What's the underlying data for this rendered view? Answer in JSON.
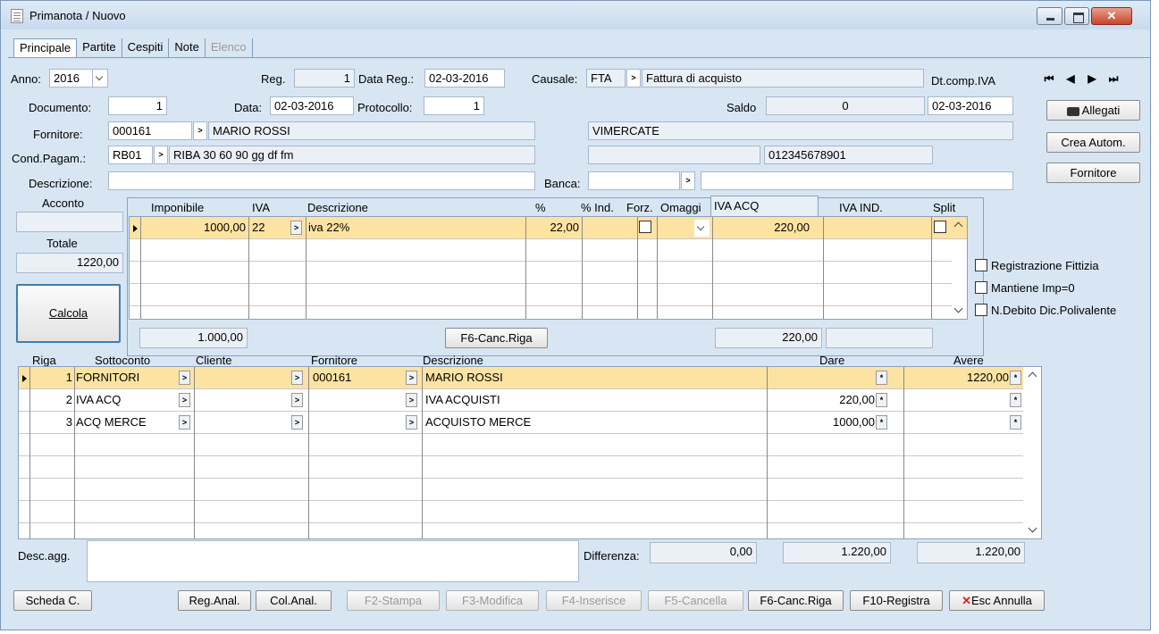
{
  "window": {
    "title": "Primanota / Nuovo",
    "close": "✕"
  },
  "tabs": [
    {
      "label": "Principale",
      "active": true
    },
    {
      "label": "Partite"
    },
    {
      "label": "Cespiti"
    },
    {
      "label": "Note"
    },
    {
      "label": "Elenco",
      "disabled": true
    }
  ],
  "header": {
    "anno_label": "Anno:",
    "anno_value": "2016",
    "reg_label": "Reg.",
    "reg_value": "1",
    "data_reg_label": "Data Reg.:",
    "data_reg_value": "02-03-2016",
    "causale_label": "Causale:",
    "causale_code": "FTA",
    "causale_desc": "Fattura di acquisto",
    "dt_comp_iva_label": "Dt.comp.IVA",
    "dt_comp_iva_value": "02-03-2016",
    "documento_label": "Documento:",
    "documento_value": "1",
    "data_label": "Data:",
    "data_value": "02-03-2016",
    "protocollo_label": "Protocollo:",
    "protocollo_value": "1",
    "saldo_label": "Saldo",
    "saldo_value": "0",
    "fornitore_label": "Fornitore:",
    "fornitore_code": "000161",
    "fornitore_name": "MARIO ROSSI",
    "citta_value": "VIMERCATE",
    "cond_pagam_label": "Cond.Pagam.:",
    "cond_pagam_code": "RB01",
    "cond_pagam_desc": "RIBA 30 60 90 gg df fm",
    "piva_value": "012345678901",
    "descrizione_label": "Descrizione:",
    "descrizione_value": "",
    "banca_label": "Banca:"
  },
  "side_buttons": {
    "allegati": "Allegati",
    "crea_autom": "Crea Autom.",
    "fornitore": "Fornitore"
  },
  "nav_buttons": [
    "⏮",
    "◀",
    "▶",
    "⏭"
  ],
  "left_panel": {
    "acconto_label": "Acconto",
    "acconto_value": "",
    "totale_label": "Totale",
    "totale_value": "1220,00",
    "calcola_label": "Calcola"
  },
  "iva_grid": {
    "headers": [
      "Imponibile",
      "IVA",
      "Descrizione",
      "%",
      "% Ind.",
      "Forz.",
      "Omaggi",
      "IVA ACQ",
      "IVA IND.",
      "Split"
    ],
    "rows": [
      {
        "imponibile": "1000,00",
        "iva": "22",
        "descrizione": "iva 22%",
        "perc": "22,00",
        "perc_ind": "",
        "iva_acq": "220,00",
        "iva_ind": ""
      }
    ],
    "total_imponibile": "1.000,00",
    "canc_riga": "F6-Canc.Riga",
    "total_iva_acq": "220,00",
    "total_iva_ind": ""
  },
  "options": {
    "reg_fittizia": "Registrazione Fittizia",
    "mantiene_imp": "Mantiene Imp=0",
    "n_debito": "N.Debito Dic.Polivalente"
  },
  "ledger": {
    "headers": [
      "Riga",
      "Sottoconto",
      "Cliente",
      "Fornitore",
      "Descrizione",
      "Dare",
      "Avere"
    ],
    "rows": [
      {
        "riga": "1",
        "sottoconto": "FORNITORI",
        "cliente": "",
        "fornitore": "000161",
        "descrizione": "MARIO ROSSI",
        "dare": "",
        "avere": "1220,00"
      },
      {
        "riga": "2",
        "sottoconto": "IVA ACQ",
        "cliente": "",
        "fornitore": "",
        "descrizione": "IVA ACQUISTI",
        "dare": "220,00",
        "avere": ""
      },
      {
        "riga": "3",
        "sottoconto": "ACQ MERCE",
        "cliente": "",
        "fornitore": "",
        "descrizione": "ACQUISTO MERCE",
        "dare": "1000,00",
        "avere": ""
      }
    ]
  },
  "footer": {
    "desc_agg_label": "Desc.agg.",
    "desc_agg_value": "",
    "differenza_label": "Differenza:",
    "differenza_value": "0,00",
    "tot_dare": "1.220,00",
    "tot_avere": "1.220,00"
  },
  "bottom_buttons": {
    "scheda": "Scheda C.",
    "reg_anal": "Reg.Anal.",
    "col_anal": "Col.Anal.",
    "f2": "F2-Stampa",
    "f3": "F3-Modifica",
    "f4": "F4-Inserisce",
    "f5": "F5-Cancella",
    "f6": "F6-Canc.Riga",
    "f10": "F10-Registra",
    "esc": "Esc Annulla",
    "esc_icon": "✕"
  }
}
